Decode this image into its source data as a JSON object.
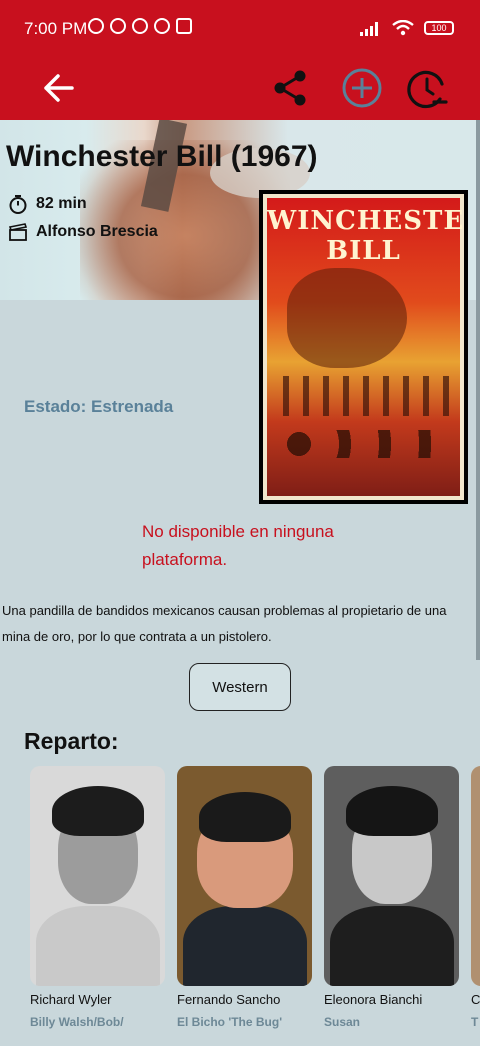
{
  "status_bar": {
    "time": "7:00 PM",
    "battery": "100"
  },
  "app_bar": {
    "back_icon": "arrow-left-icon",
    "share_icon": "share-icon",
    "add_icon": "plus-circle-icon",
    "timer_icon": "timer-minus-icon",
    "bar_color": "#c8101e"
  },
  "movie": {
    "title": "Winchester Bill (1967)",
    "duration": "82 min",
    "director": "Alfonso Brescia",
    "poster_title_line1": "WINCHESTER",
    "poster_title_line2": "BILL",
    "status": "Estado: Estrenada",
    "availability": "No disponible en ninguna plataforma.",
    "synopsis": "Una pandilla de bandidos mexicanos causan problemas al propietario de una mina de oro, por lo que contrata a un pistolero.",
    "genres": [
      "Western"
    ]
  },
  "cast_section": {
    "title": "Reparto:",
    "members": [
      {
        "name": "Richard Wyler",
        "role": "Billy Walsh/Bob/"
      },
      {
        "name": "Fernando Sancho",
        "role": "El Bicho 'The Bug'"
      },
      {
        "name": "Eleonora Bianchi",
        "role": "Susan"
      },
      {
        "name": "C",
        "role": "T"
      }
    ]
  },
  "colors": {
    "accent_red": "#c8101e",
    "status_blue": "#5a8199",
    "background": "#c9d7db"
  }
}
